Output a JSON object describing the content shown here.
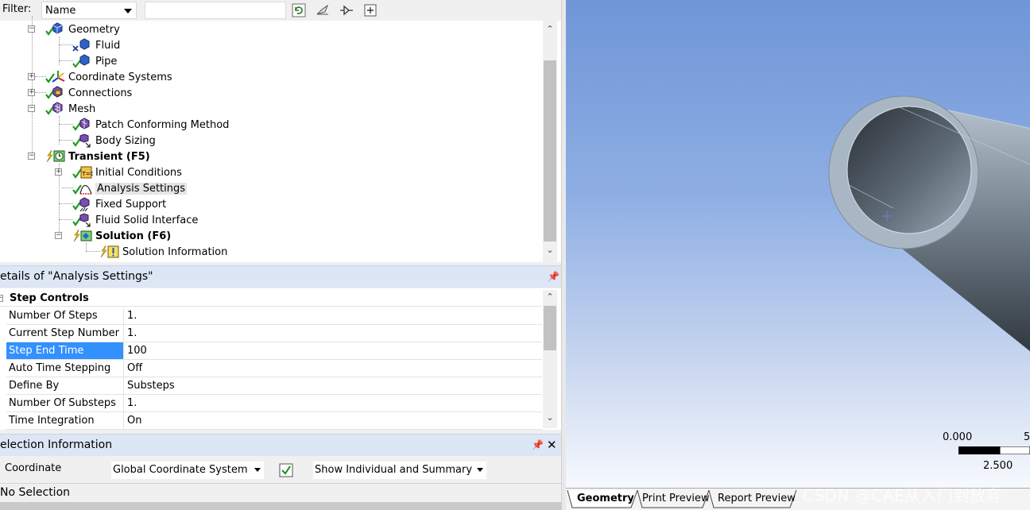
{
  "filter": {
    "label": "Filter:",
    "field_value": "Name"
  },
  "tree": {
    "geometry": "Geometry",
    "fluid": "Fluid",
    "pipe": "Pipe",
    "coordinate_systems": "Coordinate Systems",
    "connections": "Connections",
    "mesh": "Mesh",
    "patch_conforming": "Patch Conforming Method",
    "body_sizing": "Body Sizing",
    "transient": "Transient (F5)",
    "initial_conditions": "Initial Conditions",
    "analysis_settings": "Analysis Settings",
    "fixed_support": "Fixed Support",
    "fluid_solid_interface": "Fluid Solid Interface",
    "solution": "Solution (F6)",
    "solution_information": "Solution Information"
  },
  "details": {
    "title": "etails of \"Analysis Settings\"",
    "group": "Step Controls",
    "rows": [
      {
        "name": "Number Of Steps",
        "value": "1."
      },
      {
        "name": "Current Step Number",
        "value": "1."
      },
      {
        "name": "Step End Time",
        "value": "100"
      },
      {
        "name": "Auto Time Stepping",
        "value": "Off"
      },
      {
        "name": "Define By",
        "value": "Substeps"
      },
      {
        "name": "Number Of Substeps",
        "value": "1."
      },
      {
        "name": "Time Integration",
        "value": "On"
      }
    ]
  },
  "selection": {
    "title": "election Information",
    "coordinate_label": "Coordinate",
    "coordinate_value": "Global Coordinate System",
    "mode_value": "Show Individual and Summary",
    "status": "No Selection"
  },
  "viewport": {
    "scale_left": "0.000",
    "scale_right": "5",
    "scale_mid": "2.500"
  },
  "tabs": [
    "Geometry",
    "Print Preview",
    "Report Preview"
  ],
  "watermark": "CSDN @CAE从入门到放弃",
  "colors": {
    "selection_blue": "#3390ff",
    "panel_header": "#dce6f4",
    "viewport_top": "#7096d8",
    "pipe_face": "#a9b7c4"
  },
  "icons": [
    "refresh-icon",
    "expand-icon",
    "filter-icon",
    "collapse-all-icon"
  ]
}
